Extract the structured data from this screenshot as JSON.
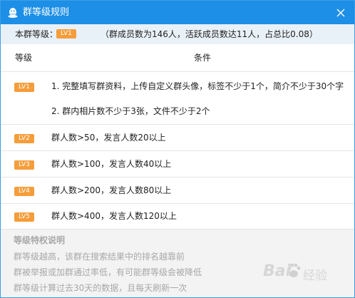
{
  "window": {
    "title": "群等级规则",
    "logo_icon": "qq-penguin-icon",
    "close_icon": "close-icon"
  },
  "summary": {
    "label": "本群等级：",
    "level_badge": "LV1",
    "detail": "（群成员数为146人，活跃成员数达11人，占总比0.08）"
  },
  "table": {
    "header_level": "等级",
    "header_condition": "条件",
    "rows": [
      {
        "badge": "LV1",
        "conditions": [
          "1. 完整填写群资料，上传自定义群头像，标签不少于1个，简介不少于30个字",
          "2. 群内相片数不少于3张，文件不少于2个"
        ]
      },
      {
        "badge": "LV2",
        "conditions": [
          "群人数>50，发言人数20以上"
        ]
      },
      {
        "badge": "LV3",
        "conditions": [
          "群人数>100，发言人数40以上"
        ]
      },
      {
        "badge": "LV4",
        "conditions": [
          "群人数>200，发言人数80以上"
        ]
      },
      {
        "badge": "LV5",
        "conditions": [
          "群人数>400，发言人数120以上"
        ]
      }
    ]
  },
  "privileges": {
    "title": "等级特权说明",
    "lines": [
      "群等级越高，该群在搜索结果中的排名越靠前",
      "群被举报或加群通过率低，有可能群等级会被降低",
      "群等级计算过去30天的数据，且每天刷新一次"
    ]
  },
  "watermark": {
    "text": "Bai",
    "text2": "经验",
    "icon": "baidu-paw-icon"
  },
  "colors": {
    "titlebar": "#1d8fe6",
    "badge": "#f59d3a",
    "summary_bg": "#e9f1f8",
    "privileges_bg": "#f3f3f3"
  }
}
